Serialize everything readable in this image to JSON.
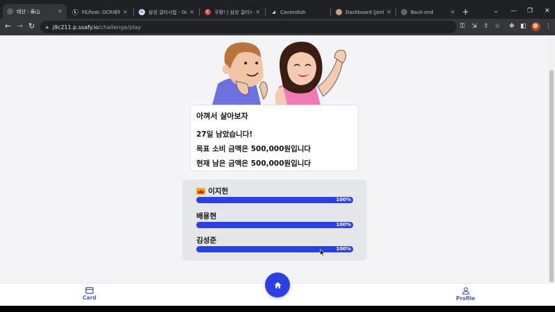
{
  "browser": {
    "tabs": [
      {
        "title": "태산 : 泰山",
        "favicon_color": "#5f6368",
        "active": true
      },
      {
        "title": "FE/feat: OCR애체 (|",
        "favicon_color": "#000000",
        "favicon_letter": "L"
      },
      {
        "title": "삼성 걸러시법 - Goo",
        "favicon_color": "#8ab4f8",
        "favicon_letter": "G"
      },
      {
        "title": "쿠팡! | 삼성 걸러시법",
        "favicon_color": "#e53935",
        "favicon_letter": "C"
      },
      {
        "title": "Cavendish",
        "favicon_color": "#5f6368"
      },
      {
        "title": "Dashboard [Jenkins]",
        "favicon_color": "#c9a27a"
      },
      {
        "title": "Back-end",
        "favicon_color": "#5f6368"
      }
    ],
    "url_host": "j9c211.p.ssafy.io",
    "url_path": "/challenge/play"
  },
  "info_card": {
    "title": "아껴서 살아보자",
    "days_left": "27일 남았습니다!",
    "target": "목표 소비 금액은 500,000원입니다",
    "remaining": "현재 남은 금액은 500,000원입니다"
  },
  "ranking": [
    {
      "name": "이지헌",
      "percent_label": "100%",
      "progress": 1.0,
      "crown": true
    },
    {
      "name": "배용현",
      "percent_label": "100%",
      "progress": 1.0,
      "crown": false
    },
    {
      "name": "김성준",
      "percent_label": "100%",
      "progress": 1.0,
      "crown": false
    }
  ],
  "bottom_nav": {
    "card_label": "Card",
    "profile_label": "Profile",
    "icons": [
      "card-icon",
      "home-icon",
      "profile-icon"
    ]
  },
  "colors": {
    "accent": "#2b3fe6",
    "nav_text": "#4a5bb8",
    "page_bg": "#f4f4f6"
  }
}
